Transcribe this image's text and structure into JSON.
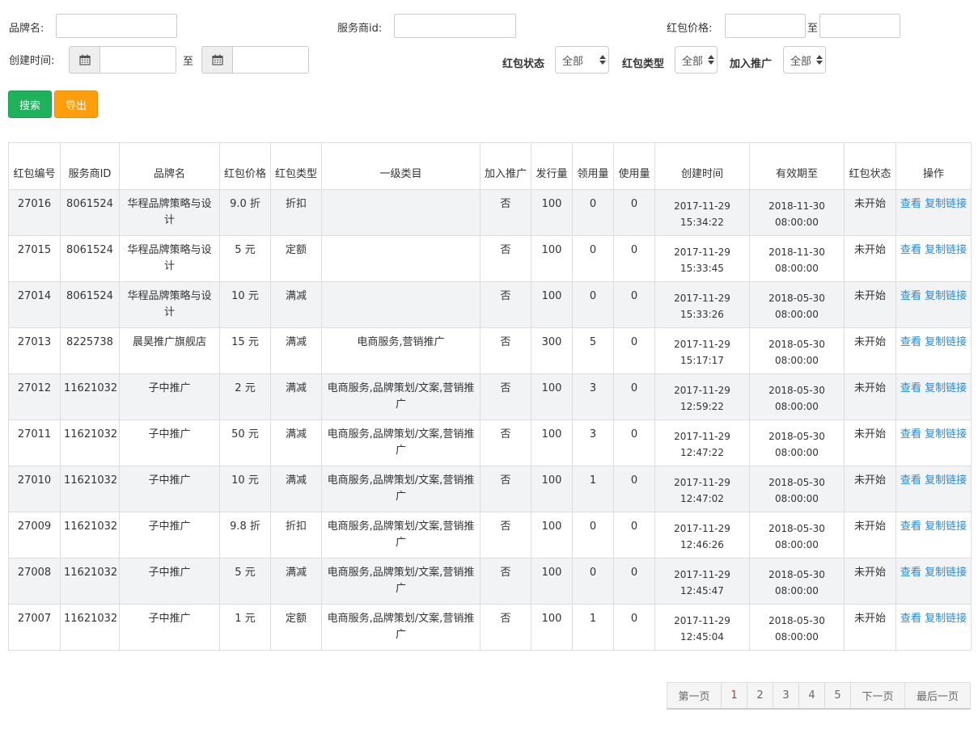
{
  "filters": {
    "brand_label": "品牌名:",
    "provider_label": "服务商id:",
    "price_label": "红包价格:",
    "price_to": "至",
    "created_label": "创建时间:",
    "created_to": "至",
    "status_label": "红包状态",
    "status_value": "全部",
    "type_label": "红包类型",
    "type_value": "全部",
    "promo_label": "加入推广",
    "promo_value": "全部"
  },
  "buttons": {
    "search": "搜索",
    "export": "导出"
  },
  "table": {
    "headers": [
      "红包编号",
      "服务商ID",
      "品牌名",
      "红包价格",
      "红包类型",
      "一级类目",
      "加入推广",
      "发行量",
      "领用量",
      "使用量",
      "创建时间",
      "有效期至",
      "红包状态",
      "操作"
    ],
    "view_label": "查看",
    "copy_label": "复制链接",
    "rows": [
      {
        "id": "27016",
        "provider": "8061524",
        "brand": "华程品牌策略与设计",
        "price": "9.0 折",
        "type": "折扣",
        "category": "",
        "promo": "否",
        "issued": "100",
        "claimed": "0",
        "used": "0",
        "created": "2017-11-29 15:34:22",
        "expires": "2018-11-30 08:00:00",
        "status": "未开始"
      },
      {
        "id": "27015",
        "provider": "8061524",
        "brand": "华程品牌策略与设计",
        "price": "5 元",
        "type": "定额",
        "category": "",
        "promo": "否",
        "issued": "100",
        "claimed": "0",
        "used": "0",
        "created": "2017-11-29 15:33:45",
        "expires": "2018-11-30 08:00:00",
        "status": "未开始"
      },
      {
        "id": "27014",
        "provider": "8061524",
        "brand": "华程品牌策略与设计",
        "price": "10 元",
        "type": "满减",
        "category": "",
        "promo": "否",
        "issued": "100",
        "claimed": "0",
        "used": "0",
        "created": "2017-11-29 15:33:26",
        "expires": "2018-05-30 08:00:00",
        "status": "未开始"
      },
      {
        "id": "27013",
        "provider": "8225738",
        "brand": "晨昊推广旗舰店",
        "price": "15 元",
        "type": "满减",
        "category": "电商服务,营销推广",
        "promo": "否",
        "issued": "300",
        "claimed": "5",
        "used": "0",
        "created": "2017-11-29 15:17:17",
        "expires": "2018-05-30 08:00:00",
        "status": "未开始"
      },
      {
        "id": "27012",
        "provider": "11621032",
        "brand": "子中推广",
        "price": "2 元",
        "type": "满减",
        "category": "电商服务,品牌策划/文案,营销推广",
        "promo": "否",
        "issued": "100",
        "claimed": "3",
        "used": "0",
        "created": "2017-11-29 12:59:22",
        "expires": "2018-05-30 08:00:00",
        "status": "未开始"
      },
      {
        "id": "27011",
        "provider": "11621032",
        "brand": "子中推广",
        "price": "50 元",
        "type": "满减",
        "category": "电商服务,品牌策划/文案,营销推广",
        "promo": "否",
        "issued": "100",
        "claimed": "3",
        "used": "0",
        "created": "2017-11-29 12:47:22",
        "expires": "2018-05-30 08:00:00",
        "status": "未开始"
      },
      {
        "id": "27010",
        "provider": "11621032",
        "brand": "子中推广",
        "price": "10 元",
        "type": "满减",
        "category": "电商服务,品牌策划/文案,营销推广",
        "promo": "否",
        "issued": "100",
        "claimed": "1",
        "used": "0",
        "created": "2017-11-29 12:47:02",
        "expires": "2018-05-30 08:00:00",
        "status": "未开始"
      },
      {
        "id": "27009",
        "provider": "11621032",
        "brand": "子中推广",
        "price": "9.8 折",
        "type": "折扣",
        "category": "电商服务,品牌策划/文案,营销推广",
        "promo": "否",
        "issued": "100",
        "claimed": "0",
        "used": "0",
        "created": "2017-11-29 12:46:26",
        "expires": "2018-05-30 08:00:00",
        "status": "未开始"
      },
      {
        "id": "27008",
        "provider": "11621032",
        "brand": "子中推广",
        "price": "5 元",
        "type": "满减",
        "category": "电商服务,品牌策划/文案,营销推广",
        "promo": "否",
        "issued": "100",
        "claimed": "0",
        "used": "0",
        "created": "2017-11-29 12:45:47",
        "expires": "2018-05-30 08:00:00",
        "status": "未开始"
      },
      {
        "id": "27007",
        "provider": "11621032",
        "brand": "子中推广",
        "price": "1 元",
        "type": "定额",
        "category": "电商服务,品牌策划/文案,营销推广",
        "promo": "否",
        "issued": "100",
        "claimed": "1",
        "used": "0",
        "created": "2017-11-29 12:45:04",
        "expires": "2018-05-30 08:00:00",
        "status": "未开始"
      }
    ]
  },
  "pagination": {
    "first": "第一页",
    "pages": [
      "1",
      "2",
      "3",
      "4",
      "5"
    ],
    "current": "1",
    "next": "下一页",
    "last": "最后一页"
  },
  "colors": {
    "search_btn": "#1fb15b",
    "export_btn": "#ff9e0d",
    "link": "#2a8ad4",
    "active_page": "#d9302b"
  }
}
